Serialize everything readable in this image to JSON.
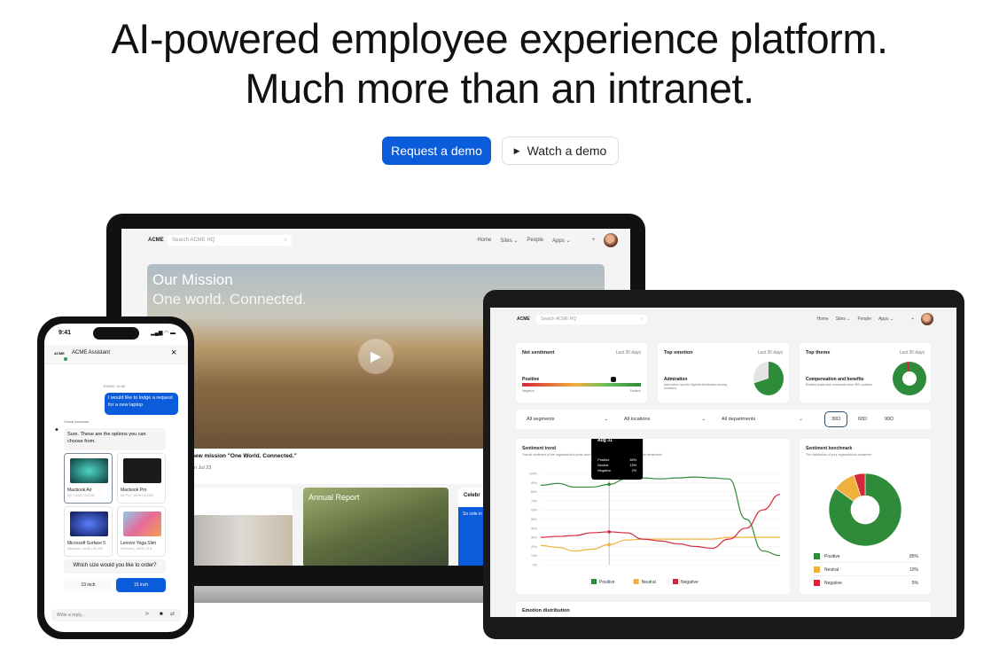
{
  "hero": {
    "line1": "AI-powered employee experience platform.",
    "line2": "Much more than an intranet.",
    "primary_button": "Request a demo",
    "secondary_button": "Watch a demo",
    "brand_color": "#0b5cdb"
  },
  "laptop": {
    "nav": {
      "logo": "ACME",
      "search_placeholder": "Search ACME HQ",
      "items": [
        "Home",
        "Sites",
        "People",
        "Apps"
      ]
    },
    "banner": {
      "title": "Our Mission",
      "subtitle": "One world. Connected."
    },
    "news": {
      "headline": "new mission \"One World. Connected.\"",
      "date": "on Jul 23"
    },
    "cards": [
      {
        "title": ""
      },
      {
        "title": "Annual Report"
      },
      {
        "title": "Celebr",
        "text": "So cele in the n"
      }
    ]
  },
  "phone": {
    "time": "9:41",
    "logo": "ACME",
    "title": "ACME Assistant",
    "timestamp": "TODAY, 11:46",
    "user_message": "I would like to lodge a request for a new laptop",
    "assistant_label": "Virtual Assistant",
    "assistant_message": "Sure. These are the options you can choose from.",
    "products": [
      {
        "name": "Macbook Air",
        "sub": "M3 | 16GB | 512GB",
        "selected": true
      },
      {
        "name": "Macbook Pro",
        "sub": "M3 Pro | 18GB | 512GB",
        "selected": false
      },
      {
        "name": "Microsoft Surface 5",
        "sub": "Windows | 16GB | 512GB",
        "selected": false
      },
      {
        "name": "Lenovo Yoga Slim",
        "sub": "Windows | 16GB | 1TB",
        "selected": false
      }
    ],
    "question": "Which size would you like to order?",
    "options": [
      "13 inch",
      "15 inch"
    ],
    "selected_option": "15 inch",
    "reply_placeholder": "Write a reply..."
  },
  "tablet": {
    "nav": {
      "logo": "ACME",
      "search_placeholder": "Search ACME HQ",
      "items": [
        "Home",
        "Sites",
        "People",
        "Apps"
      ]
    },
    "net_sentiment": {
      "title": "Net sentiment",
      "period": "Last 30 days",
      "value_label": "Positive",
      "min_label": "Negative",
      "max_label": "Positive",
      "position": 0.77
    },
    "top_emotion": {
      "title": "Top emotion",
      "period": "Last 30 days",
      "name": "Admiration",
      "desc": "Admiration has the highest distribution among emotions",
      "share": 0.7
    },
    "top_theme": {
      "title": "Top theme",
      "period": "Last 30 days",
      "name": "Compensation and benefits",
      "desc": "Related posts and comments were 95% positive",
      "share": 0.97
    },
    "filters": [
      "All segments",
      "All locations",
      "All departments"
    ],
    "range_options": [
      "30D",
      "60D",
      "90D"
    ],
    "range_selected": "30D",
    "benchmark": {
      "title": "Sentiment benchmark",
      "subtitle": "The distribution of your organization's sentiment",
      "items": [
        {
          "label": "Positive",
          "value": "85%",
          "color": "#2e8b3a"
        },
        {
          "label": "Neutral",
          "value": "10%",
          "color": "#f0b03c"
        },
        {
          "label": "Negative",
          "value": "5%",
          "color": "#d6263a"
        }
      ]
    },
    "emotion_title": "Emotion distribution"
  },
  "chart_data": {
    "type": "line",
    "title": "Sentiment trend",
    "subtitle": "Overall sentiment of the organization's posts and comments falls into one of three possible sentiments",
    "ylim": [
      0,
      100
    ],
    "yticks": [
      "100%",
      "90%",
      "80%",
      "70%",
      "60%",
      "50%",
      "40%",
      "30%",
      "20%",
      "10%",
      "0%"
    ],
    "grid": true,
    "legend": "bottom",
    "series": [
      {
        "name": "Positive",
        "color": "#2e8b3a",
        "values": [
          87,
          89,
          85,
          85,
          88,
          94,
          95,
          94,
          95,
          96,
          95,
          94,
          50,
          15,
          10
        ]
      },
      {
        "name": "Neutral",
        "color": "#f0b03c",
        "values": [
          21,
          19,
          15,
          17,
          22,
          27,
          28,
          28,
          28,
          28,
          28,
          30,
          30,
          30,
          30
        ]
      },
      {
        "name": "Negative",
        "color": "#d6263a",
        "values": [
          30,
          31,
          32,
          35,
          36,
          35,
          28,
          26,
          23,
          20,
          18,
          28,
          40,
          60,
          77
        ]
      }
    ],
    "tooltip": {
      "date": "Aug 31",
      "index": 4,
      "rows": [
        {
          "label": "Positive",
          "value": "85%"
        },
        {
          "label": "Neutral",
          "value": "15%"
        },
        {
          "label": "Negative",
          "value": "2%"
        }
      ]
    }
  }
}
